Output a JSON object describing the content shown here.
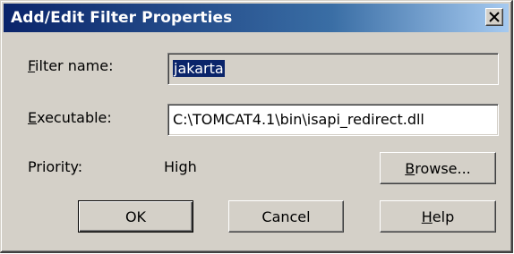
{
  "window": {
    "title": "Add/Edit Filter Properties",
    "titlebar_color_start": "#0a246a",
    "titlebar_color_end": "#a6caf0"
  },
  "filter_name": {
    "label_first": "F",
    "label_rest": "ilter name:",
    "value": "jakarta"
  },
  "executable": {
    "label_first": "E",
    "label_rest": "xecutable:",
    "value": "C:\\TOMCAT4.1\\bin\\isapi_redirect.dll"
  },
  "priority": {
    "label": "Priority:",
    "value": "High"
  },
  "buttons": {
    "browse_first": "B",
    "browse_rest": "rowse...",
    "ok": "OK",
    "cancel": "Cancel",
    "help_first": "H",
    "help_rest": "elp"
  },
  "icons": {
    "close": "close-icon"
  }
}
